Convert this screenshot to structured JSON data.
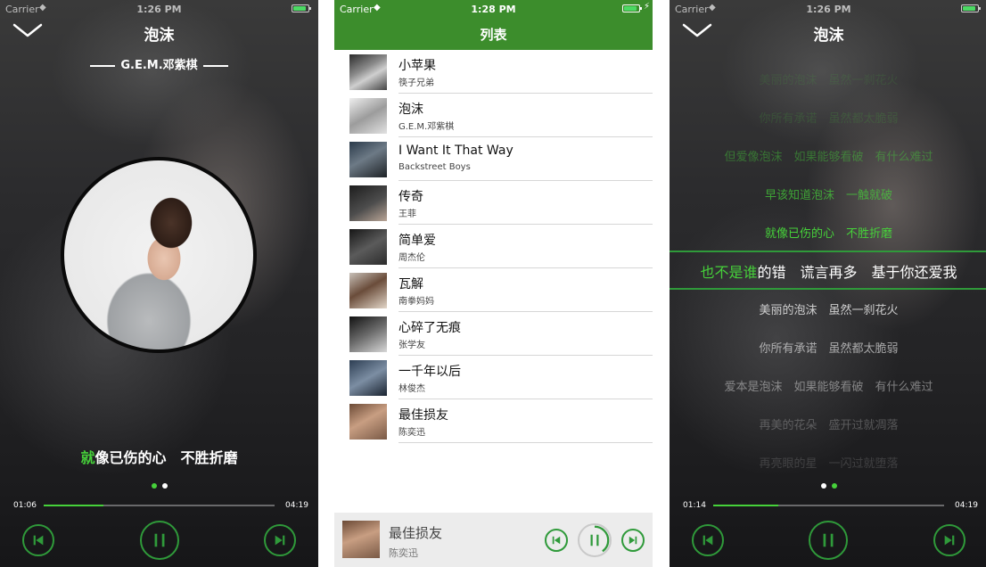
{
  "left_player": {
    "status": {
      "carrier": "Carrier",
      "time": "1:26 PM"
    },
    "title": "泡沫",
    "singer": "G.E.M.邓紫棋",
    "lyric_highlight": "就",
    "lyric_rest": "像已伤的心　不胜折磨",
    "time_current": "01:06",
    "time_total": "04:19",
    "progress": 0.26,
    "page_dots": [
      true,
      false
    ]
  },
  "song_list": {
    "status": {
      "carrier": "Carrier",
      "time": "1:28 PM"
    },
    "nav_title": "列表",
    "songs": [
      {
        "name": "小苹果",
        "artist": "筷子兄弟"
      },
      {
        "name": "泡沫",
        "artist": "G.E.M.邓紫棋"
      },
      {
        "name": "I Want It That Way",
        "artist": "Backstreet Boys"
      },
      {
        "name": "传奇",
        "artist": "王菲"
      },
      {
        "name": "简单爱",
        "artist": "周杰伦"
      },
      {
        "name": "瓦解",
        "artist": "南拳妈妈"
      },
      {
        "name": "心碎了无痕",
        "artist": "张学友"
      },
      {
        "name": "一千年以后",
        "artist": "林俊杰"
      },
      {
        "name": "最佳损友",
        "artist": "陈奕迅"
      }
    ],
    "mini_player": {
      "name": "最佳损友",
      "artist": "陈奕迅",
      "progress": 0.4
    }
  },
  "right_player": {
    "status": {
      "carrier": "Carrier",
      "time": "1:26 PM"
    },
    "title": "泡沫",
    "lyrics": [
      "美丽的泡沫　虽然一刹花火",
      "你所有承诺　虽然都太脆弱",
      "但爱像泡沫　如果能够看破　有什么难过",
      "早该知道泡沫　一触就破",
      "就像已伤的心　不胜折磨",
      "也不是谁的错　谎言再多　基于你还爱我",
      "美丽的泡沫　虽然一刹花火",
      "你所有承诺　虽然都太脆弱",
      "爱本是泡沫　如果能够看破　有什么难过",
      "再美的花朵　盛开过就凋落",
      "再亮眼的星　一闪过就堕落"
    ],
    "current_index": 5,
    "current_highlight": "也不是谁",
    "current_rest": "的错　谎言再多　基于你还爱我",
    "time_current": "01:14",
    "time_total": "04:19",
    "progress": 0.28,
    "page_dots": [
      false,
      true
    ],
    "colors": {
      "accent": "#46d13a",
      "ring": "#2f9a3a",
      "navbar": "#3c8d2c"
    }
  }
}
